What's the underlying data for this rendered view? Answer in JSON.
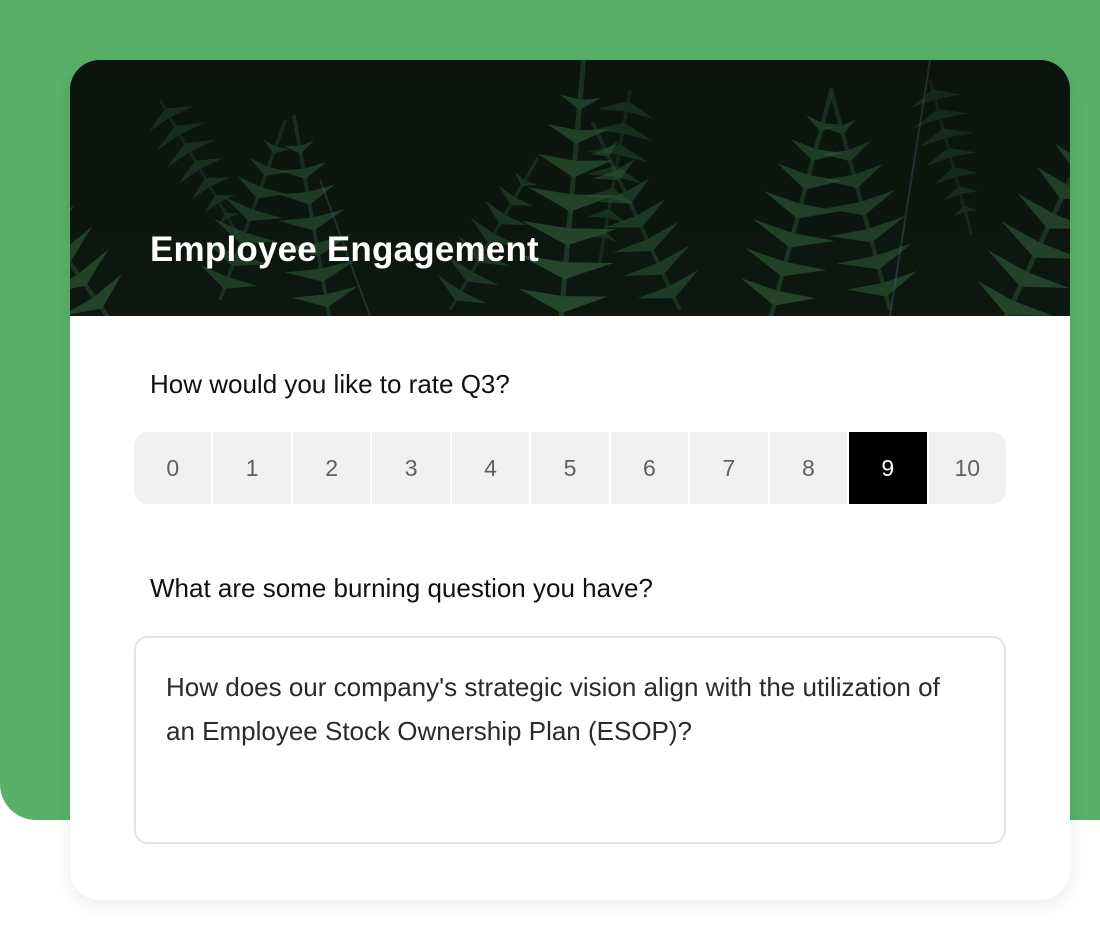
{
  "survey": {
    "title": "Employee Engagement",
    "questions": [
      {
        "label": "How would you like to rate Q3?",
        "options": [
          "0",
          "1",
          "2",
          "3",
          "4",
          "5",
          "6",
          "7",
          "8",
          "9",
          "10"
        ],
        "selected": "9"
      },
      {
        "label": "What are some burning question you have?",
        "answer": "How does our company's strategic vision align with the utilization of an Employee Stock Ownership Plan (ESOP)?"
      }
    ]
  },
  "colors": {
    "page_background": "#59b068",
    "card_background": "#ffffff",
    "banner_overlay": "#0c1a10",
    "selected_option": "#000000",
    "option_background": "#f0f0f0"
  },
  "icons": {
    "banner_image": "fern-leaves-image"
  }
}
